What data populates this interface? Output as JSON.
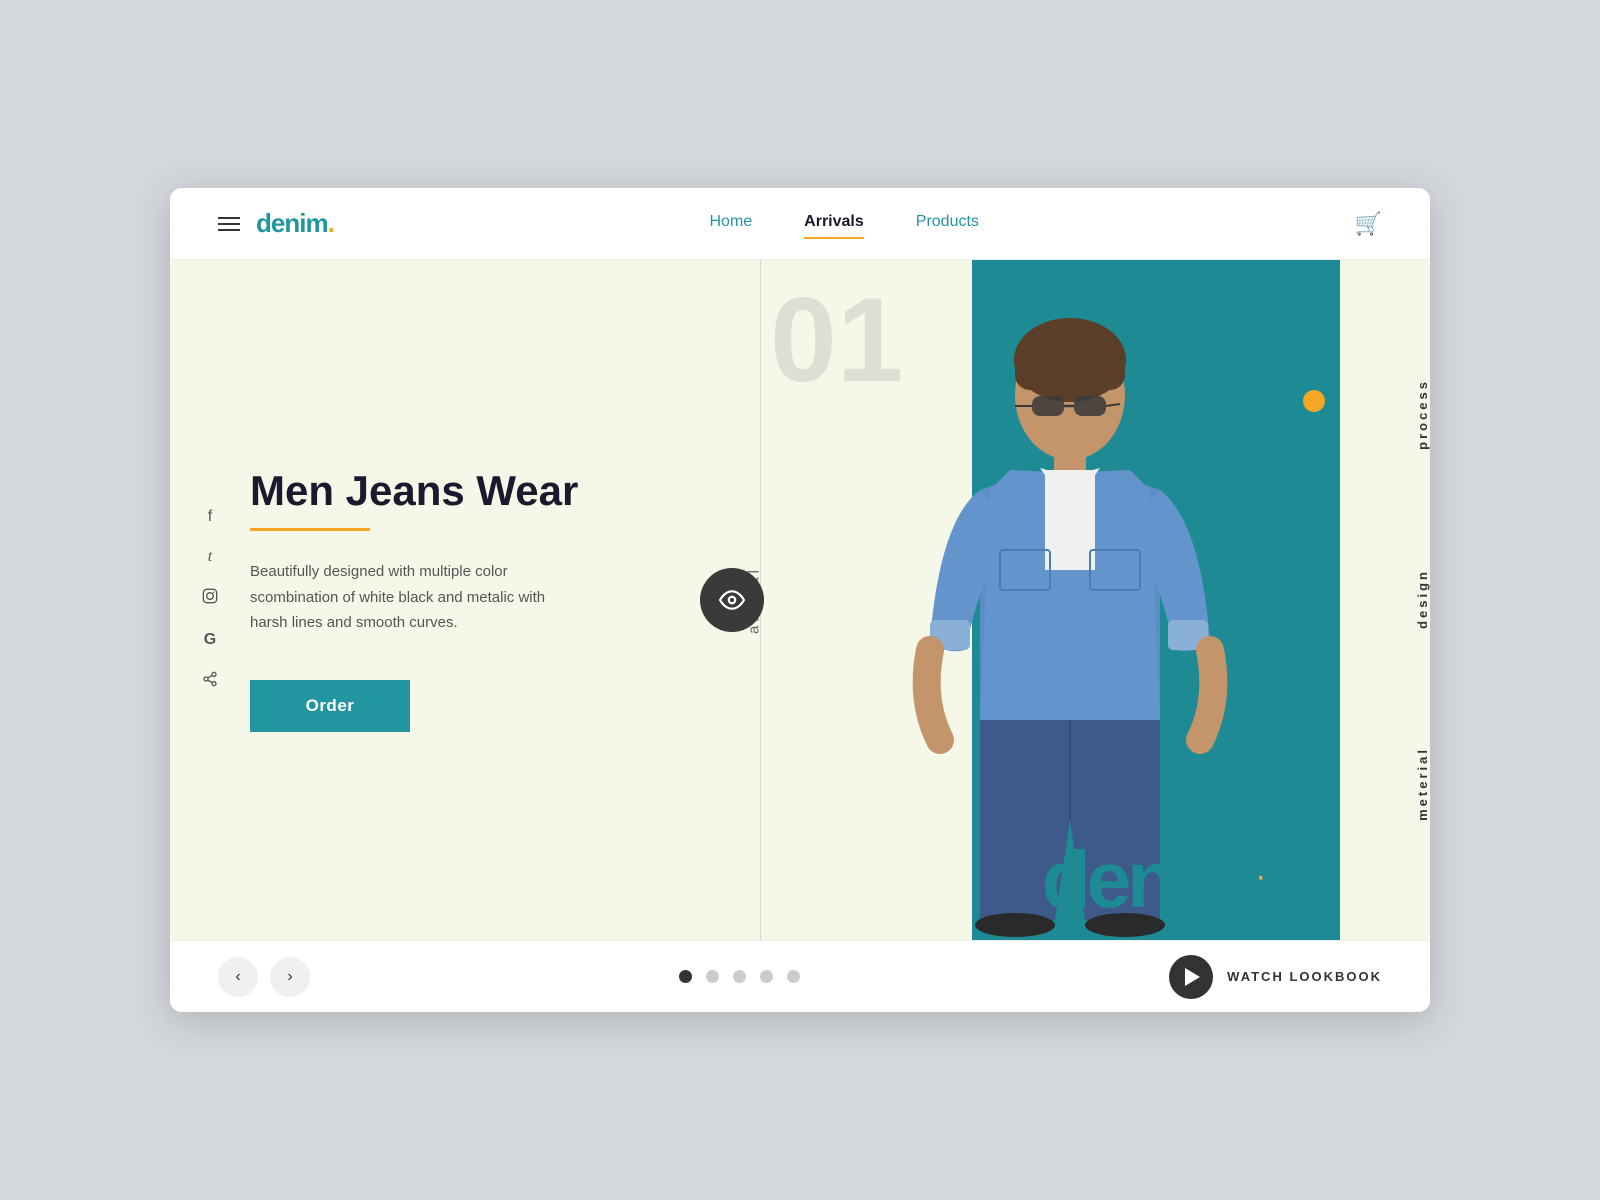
{
  "header": {
    "hamburger_label": "menu",
    "logo_text": "denim",
    "logo_dot": ".",
    "nav": [
      {
        "id": "home",
        "label": "Home",
        "active": false
      },
      {
        "id": "arrivals",
        "label": "Arrivals",
        "active": true
      },
      {
        "id": "products",
        "label": "Products",
        "active": false
      }
    ],
    "cart_icon": "🛒"
  },
  "social": {
    "items": [
      {
        "id": "facebook",
        "icon": "f"
      },
      {
        "id": "twitter",
        "icon": "𝕥"
      },
      {
        "id": "instagram",
        "icon": "◎"
      },
      {
        "id": "google",
        "icon": "G"
      },
      {
        "id": "share",
        "icon": "⋊"
      }
    ]
  },
  "hero": {
    "article_label": "artical",
    "article_number": "01",
    "product_title": "Men Jeans Wear",
    "title_underline": true,
    "description": "Beautifully designed with multiple color scombination of white black and metalic with harsh lines and smooth curves.",
    "order_button": "Order",
    "eye_btn_label": "view"
  },
  "right_sidebar": {
    "items": [
      {
        "id": "process",
        "label": "process"
      },
      {
        "id": "design",
        "label": "design"
      },
      {
        "id": "material",
        "label": "meterial"
      }
    ],
    "brand_text": "denim",
    "brand_dot": ".",
    "orange_dot": true
  },
  "footer": {
    "prev_label": "‹",
    "next_label": "›",
    "dots": [
      {
        "id": 1,
        "active": true
      },
      {
        "id": 2,
        "active": false
      },
      {
        "id": 3,
        "active": false
      },
      {
        "id": 4,
        "active": false
      },
      {
        "id": 5,
        "active": false
      }
    ],
    "watch_label": "WATCH LOOKBOOK",
    "play_label": "play"
  },
  "colors": {
    "teal": "#1d8a94",
    "orange": "#f5a623",
    "dark": "#1a1a2e",
    "bg_cream": "#f5f7e8"
  }
}
